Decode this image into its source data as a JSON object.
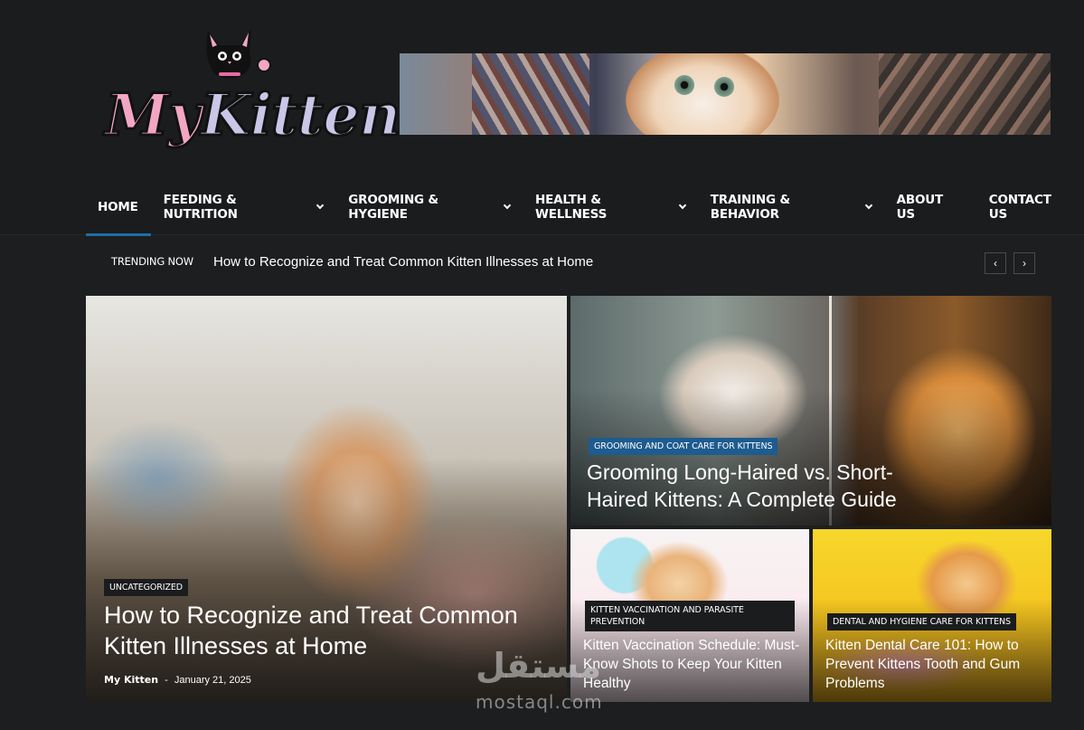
{
  "logo": {
    "text_part1": "My",
    "text_part2": "Kitten"
  },
  "nav": {
    "items": [
      {
        "label": "HOME",
        "dropdown": false,
        "active": true
      },
      {
        "label": "FEEDING & NUTRITION",
        "dropdown": true
      },
      {
        "label": "GROOMING & HYGIENE",
        "dropdown": true
      },
      {
        "label": "HEALTH & WELLNESS",
        "dropdown": true
      },
      {
        "label": "TRAINING & BEHAVIOR",
        "dropdown": true
      },
      {
        "label": "ABOUT US",
        "dropdown": false
      },
      {
        "label": "CONTACT US",
        "dropdown": false
      }
    ]
  },
  "trending": {
    "label": "TRENDING NOW",
    "text": "How to Recognize and Treat Common Kitten Illnesses at Home",
    "prev_icon": "chevron-left-icon",
    "next_icon": "chevron-right-icon"
  },
  "featured": {
    "main": {
      "category": "UNCATEGORIZED",
      "title": "How to Recognize and Treat Common Kitten Illnesses at Home",
      "author": "My Kitten",
      "separator": "-",
      "date": "January 21, 2025"
    },
    "top": {
      "category": "GROOMING AND COAT CARE FOR KITTENS",
      "title": "Grooming Long-Haired vs. Short-Haired Kittens: A Complete Guide"
    },
    "bottom_left": {
      "category": "KITTEN VACCINATION AND PARASITE PREVENTION",
      "title": "Kitten Vaccination Schedule: Must-Know Shots to Keep Your Kitten Healthy"
    },
    "bottom_right": {
      "category": "DENTAL AND HYGIENE CARE FOR KITTENS",
      "title": "Kitten Dental Care 101: How to Prevent Kittens Tooth and Gum Problems"
    }
  },
  "watermark": {
    "arabic": "مستقل",
    "latin": "mostaql.com"
  },
  "colors": {
    "accent": "#1e6ea7",
    "background": "#1d1e20",
    "badge_blue": "#1e5b8f"
  }
}
